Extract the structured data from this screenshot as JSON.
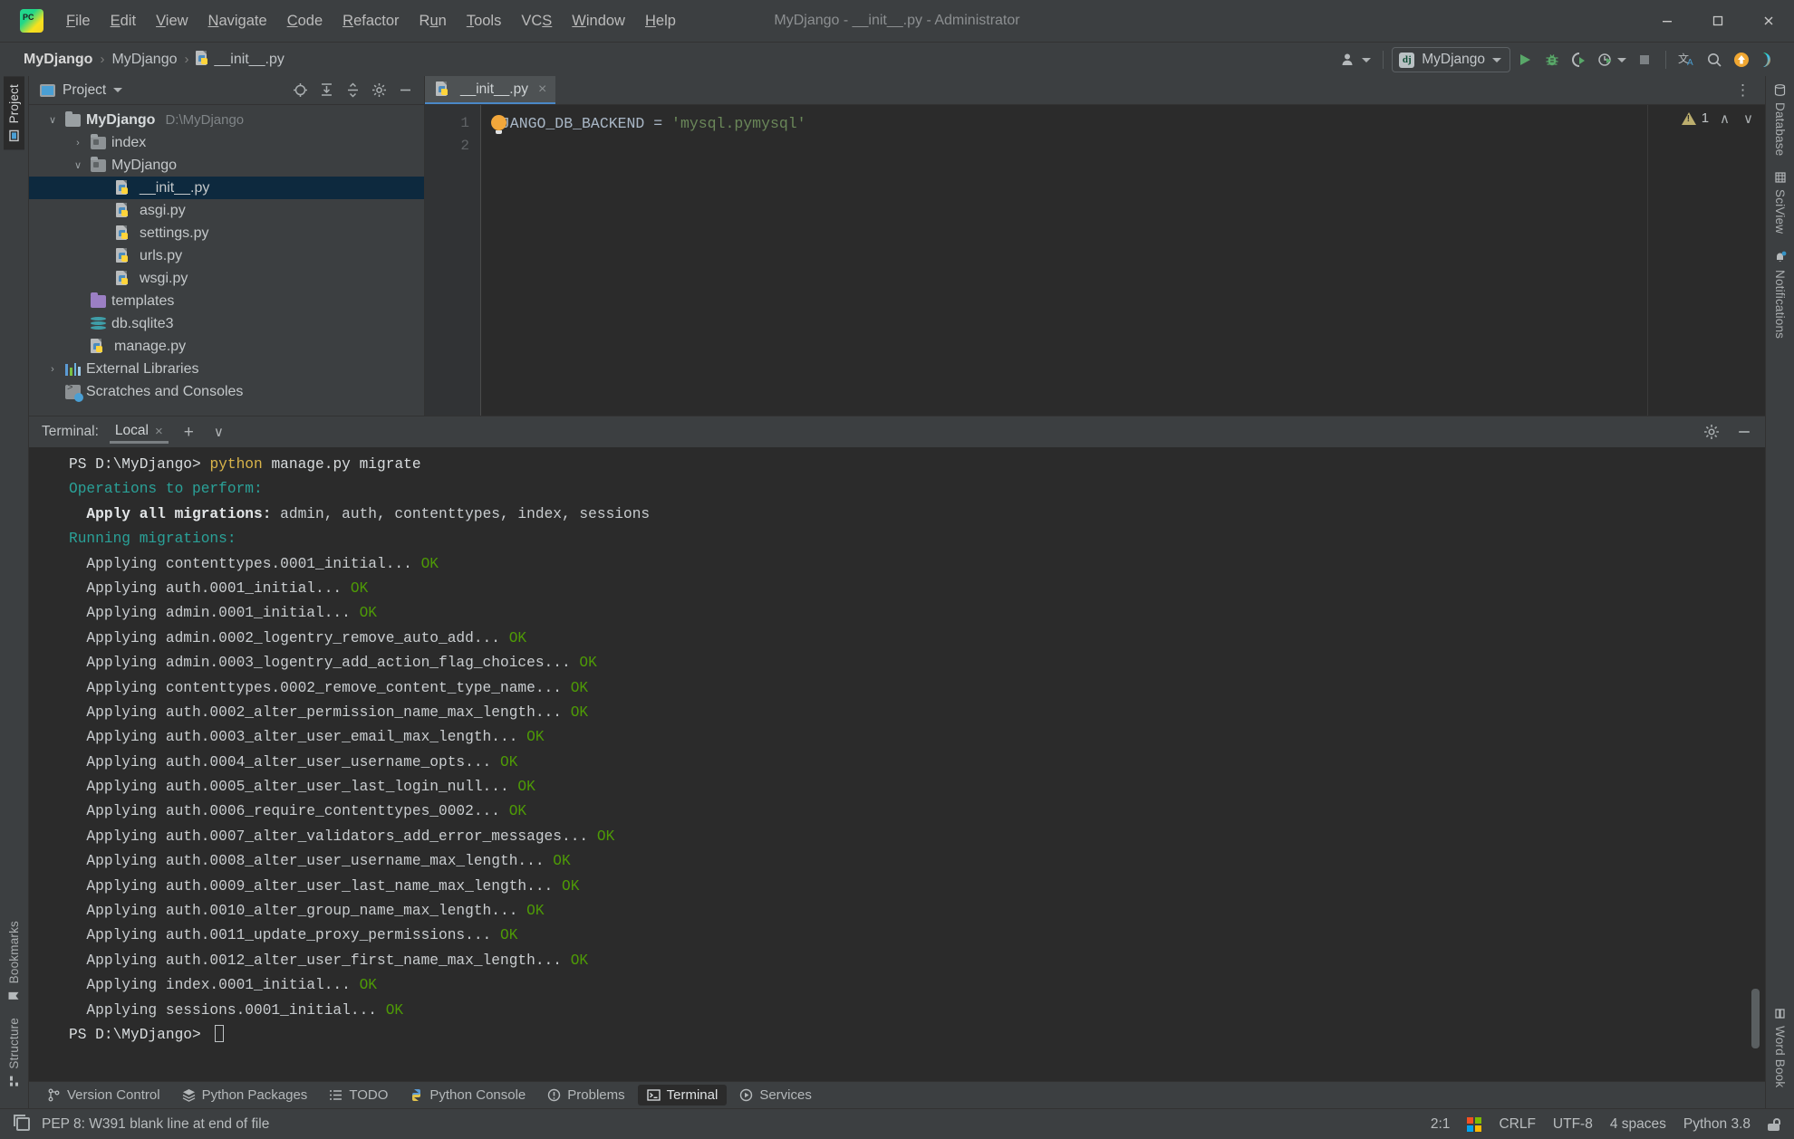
{
  "window": {
    "title": "MyDjango - __init__.py - Administrator",
    "minimize": "minimize-button",
    "maximize": "maximize-button",
    "close": "close-button"
  },
  "menu": [
    {
      "label": "File"
    },
    {
      "label": "Edit"
    },
    {
      "label": "View"
    },
    {
      "label": "Navigate"
    },
    {
      "label": "Code"
    },
    {
      "label": "Refactor"
    },
    {
      "label": "Run"
    },
    {
      "label": "Tools"
    },
    {
      "label": "VCS"
    },
    {
      "label": "Window"
    },
    {
      "label": "Help"
    }
  ],
  "breadcrumbs": [
    {
      "label": "MyDjango"
    },
    {
      "label": "MyDjango"
    },
    {
      "label": "__init__.py"
    }
  ],
  "toolbar": {
    "run_config": "MyDjango",
    "run_config_icon": "django-icon",
    "buttons": [
      {
        "name": "user-settings-button",
        "icon": "user-icon"
      },
      {
        "name": "run-button",
        "icon": "play-icon"
      },
      {
        "name": "debug-button",
        "icon": "bug-icon"
      },
      {
        "name": "run-with-coverage-button",
        "icon": "coverage-icon"
      },
      {
        "name": "profile-button",
        "icon": "clock-play-icon"
      },
      {
        "name": "stop-button",
        "icon": "stop-square-icon"
      },
      {
        "name": "translate-button",
        "icon": "translate-icon"
      },
      {
        "name": "search-everywhere-button",
        "icon": "search-icon"
      },
      {
        "name": "update-project-button",
        "icon": "orange-arrow-up-icon"
      },
      {
        "name": "plugin-button",
        "icon": "rainbow-play-icon"
      }
    ]
  },
  "left_stripe": [
    {
      "label": "Project",
      "icon": "project-icon",
      "active": true
    },
    {
      "label": "Bookmarks",
      "icon": "bookmark-icon",
      "active": false
    },
    {
      "label": "Structure",
      "icon": "structure-icon",
      "active": false
    }
  ],
  "right_stripe": [
    {
      "label": "Database",
      "icon": "database-icon"
    },
    {
      "label": "SciView",
      "icon": "grid-icon"
    },
    {
      "label": "Notifications",
      "icon": "bell-icon"
    },
    {
      "label": "Word Book",
      "icon": "book-icon"
    }
  ],
  "project_panel": {
    "title": "Project",
    "actions": [
      {
        "name": "select-opened-file-button",
        "icon": "target-icon"
      },
      {
        "name": "expand-all-button",
        "icon": "expand-all-icon"
      },
      {
        "name": "collapse-all-button",
        "icon": "collapse-all-icon"
      },
      {
        "name": "options-button",
        "icon": "gear-icon"
      },
      {
        "name": "hide-button",
        "icon": "minus-icon"
      }
    ],
    "tree": [
      {
        "name": "MyDjango",
        "path": "D:\\MyDjango",
        "icon": "folder-icon",
        "indent": 0,
        "arrow": "expanded",
        "bold": true,
        "selected": false
      },
      {
        "name": "index",
        "path": "",
        "icon": "source-folder-icon",
        "indent": 1,
        "arrow": "collapsed",
        "bold": false,
        "selected": false
      },
      {
        "name": "MyDjango",
        "path": "",
        "icon": "source-folder-icon",
        "indent": 1,
        "arrow": "expanded",
        "bold": false,
        "selected": false
      },
      {
        "name": "__init__.py",
        "path": "",
        "icon": "python-file-icon",
        "indent": 2,
        "arrow": "none",
        "bold": false,
        "selected": true
      },
      {
        "name": "asgi.py",
        "path": "",
        "icon": "python-file-icon",
        "indent": 2,
        "arrow": "none",
        "bold": false,
        "selected": false
      },
      {
        "name": "settings.py",
        "path": "",
        "icon": "python-file-icon",
        "indent": 2,
        "arrow": "none",
        "bold": false,
        "selected": false
      },
      {
        "name": "urls.py",
        "path": "",
        "icon": "python-file-icon",
        "indent": 2,
        "arrow": "none",
        "bold": false,
        "selected": false
      },
      {
        "name": "wsgi.py",
        "path": "",
        "icon": "python-file-icon",
        "indent": 2,
        "arrow": "none",
        "bold": false,
        "selected": false
      },
      {
        "name": "templates",
        "path": "",
        "icon": "templates-folder-icon",
        "indent": 1,
        "arrow": "none",
        "bold": false,
        "selected": false
      },
      {
        "name": "db.sqlite3",
        "path": "",
        "icon": "database-file-icon",
        "indent": 1,
        "arrow": "none",
        "bold": false,
        "selected": false
      },
      {
        "name": "manage.py",
        "path": "",
        "icon": "python-file-icon",
        "indent": 1,
        "arrow": "none",
        "bold": false,
        "selected": false
      },
      {
        "name": "External Libraries",
        "path": "",
        "icon": "libraries-icon",
        "indent": 0,
        "arrow": "collapsed",
        "bold": false,
        "selected": false
      },
      {
        "name": "Scratches and Consoles",
        "path": "",
        "icon": "scratches-icon",
        "indent": 0,
        "arrow": "none",
        "bold": false,
        "selected": false
      }
    ]
  },
  "editor": {
    "tab": {
      "label": "__init__.py",
      "icon": "python-file-icon",
      "close": "×"
    },
    "more": "⋮",
    "line_numbers": [
      "1",
      "2"
    ],
    "code": {
      "variable": "DJANGO_DB_BACKEND",
      "operator": " = ",
      "string": "'mysql.pymysql'"
    },
    "inspection": {
      "warning_count": "1",
      "prev": "∧",
      "next": "∨"
    }
  },
  "terminal": {
    "label": "Terminal:",
    "tab": "Local",
    "tab_close": "×",
    "add": "+",
    "dropdown": "∨",
    "settings_icon": "gear-icon",
    "hide_icon": "minus-icon",
    "lines": [
      {
        "parts": [
          {
            "t": "PS D:\\MyDjango> ",
            "c": "c-white"
          },
          {
            "t": "python",
            "c": "c-yellow"
          },
          {
            "t": " manage.py migrate",
            "c": "c-white"
          }
        ]
      },
      {
        "parts": [
          {
            "t": "Operations to perform:",
            "c": "c-cyan"
          }
        ]
      },
      {
        "parts": [
          {
            "t": "  Apply all migrations:",
            "c": "c-bold"
          },
          {
            "t": " admin, auth, contenttypes, index, sessions",
            "c": ""
          }
        ]
      },
      {
        "parts": [
          {
            "t": "Running migrations:",
            "c": "c-cyan"
          }
        ]
      },
      {
        "parts": [
          {
            "t": "  Applying contenttypes.0001_initial... ",
            "c": ""
          },
          {
            "t": "OK",
            "c": "c-green"
          }
        ]
      },
      {
        "parts": [
          {
            "t": "  Applying auth.0001_initial... ",
            "c": ""
          },
          {
            "t": "OK",
            "c": "c-green"
          }
        ]
      },
      {
        "parts": [
          {
            "t": "  Applying admin.0001_initial... ",
            "c": ""
          },
          {
            "t": "OK",
            "c": "c-green"
          }
        ]
      },
      {
        "parts": [
          {
            "t": "  Applying admin.0002_logentry_remove_auto_add... ",
            "c": ""
          },
          {
            "t": "OK",
            "c": "c-green"
          }
        ]
      },
      {
        "parts": [
          {
            "t": "  Applying admin.0003_logentry_add_action_flag_choices... ",
            "c": ""
          },
          {
            "t": "OK",
            "c": "c-green"
          }
        ]
      },
      {
        "parts": [
          {
            "t": "  Applying contenttypes.0002_remove_content_type_name... ",
            "c": ""
          },
          {
            "t": "OK",
            "c": "c-green"
          }
        ]
      },
      {
        "parts": [
          {
            "t": "  Applying auth.0002_alter_permission_name_max_length... ",
            "c": ""
          },
          {
            "t": "OK",
            "c": "c-green"
          }
        ]
      },
      {
        "parts": [
          {
            "t": "  Applying auth.0003_alter_user_email_max_length... ",
            "c": ""
          },
          {
            "t": "OK",
            "c": "c-green"
          }
        ]
      },
      {
        "parts": [
          {
            "t": "  Applying auth.0004_alter_user_username_opts... ",
            "c": ""
          },
          {
            "t": "OK",
            "c": "c-green"
          }
        ]
      },
      {
        "parts": [
          {
            "t": "  Applying auth.0005_alter_user_last_login_null... ",
            "c": ""
          },
          {
            "t": "OK",
            "c": "c-green"
          }
        ]
      },
      {
        "parts": [
          {
            "t": "  Applying auth.0006_require_contenttypes_0002... ",
            "c": ""
          },
          {
            "t": "OK",
            "c": "c-green"
          }
        ]
      },
      {
        "parts": [
          {
            "t": "  Applying auth.0007_alter_validators_add_error_messages... ",
            "c": ""
          },
          {
            "t": "OK",
            "c": "c-green"
          }
        ]
      },
      {
        "parts": [
          {
            "t": "  Applying auth.0008_alter_user_username_max_length... ",
            "c": ""
          },
          {
            "t": "OK",
            "c": "c-green"
          }
        ]
      },
      {
        "parts": [
          {
            "t": "  Applying auth.0009_alter_user_last_name_max_length... ",
            "c": ""
          },
          {
            "t": "OK",
            "c": "c-green"
          }
        ]
      },
      {
        "parts": [
          {
            "t": "  Applying auth.0010_alter_group_name_max_length... ",
            "c": ""
          },
          {
            "t": "OK",
            "c": "c-green"
          }
        ]
      },
      {
        "parts": [
          {
            "t": "  Applying auth.0011_update_proxy_permissions... ",
            "c": ""
          },
          {
            "t": "OK",
            "c": "c-green"
          }
        ]
      },
      {
        "parts": [
          {
            "t": "  Applying auth.0012_alter_user_first_name_max_length... ",
            "c": ""
          },
          {
            "t": "OK",
            "c": "c-green"
          }
        ]
      },
      {
        "parts": [
          {
            "t": "  Applying index.0001_initial... ",
            "c": ""
          },
          {
            "t": "OK",
            "c": "c-green"
          }
        ]
      },
      {
        "parts": [
          {
            "t": "  Applying sessions.0001_initial... ",
            "c": ""
          },
          {
            "t": "OK",
            "c": "c-green"
          }
        ]
      },
      {
        "parts": [
          {
            "t": "PS D:\\MyDjango> ",
            "c": "c-white"
          }
        ],
        "cursor": true
      }
    ]
  },
  "tool_window_bar": [
    {
      "label": "Version Control",
      "icon": "branch-icon",
      "active": false
    },
    {
      "label": "Python Packages",
      "icon": "packages-icon",
      "active": false
    },
    {
      "label": "TODO",
      "icon": "list-icon",
      "active": false
    },
    {
      "label": "Python Console",
      "icon": "python-icon",
      "active": false
    },
    {
      "label": "Problems",
      "icon": "error-icon",
      "active": false
    },
    {
      "label": "Terminal",
      "icon": "terminal-icon",
      "active": true
    },
    {
      "label": "Services",
      "icon": "services-icon",
      "active": false
    }
  ],
  "statusbar": {
    "message": "PEP 8: W391 blank line at end of file",
    "message_icon": "window-icon",
    "caret": "2:1",
    "line_separator": "CRLF",
    "encoding": "UTF-8",
    "indent": "4 spaces",
    "interpreter": "Python 3.8",
    "lock_icon": "lock-icon",
    "os_icon": "windows-logo"
  },
  "colors": {
    "accent_blue": "#4a88c7",
    "selection_blue": "#0d293e",
    "terminal_green": "#4e9a06",
    "terminal_cyan": "#2aa198",
    "terminal_yellow": "#d9b44a",
    "string_green": "#6a8759",
    "bulb_orange": "#f2a73b"
  }
}
